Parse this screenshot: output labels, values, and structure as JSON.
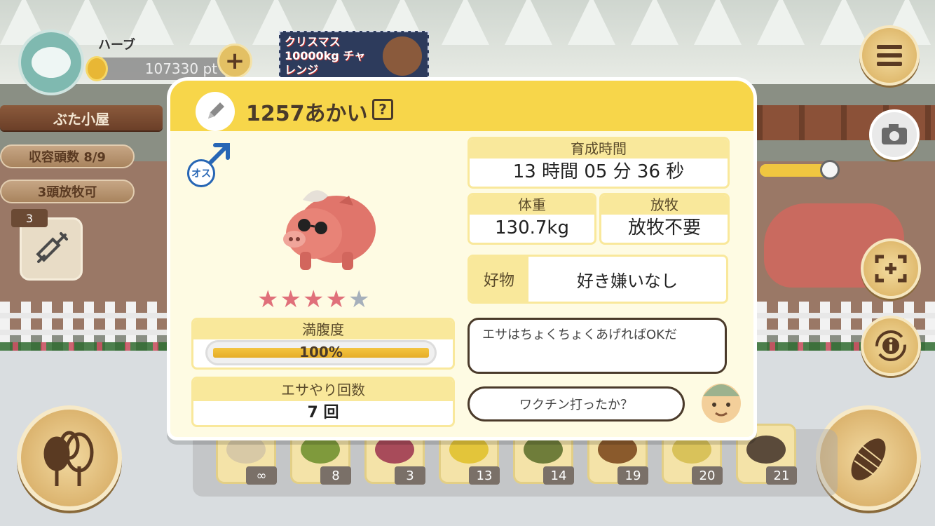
{
  "hud": {
    "player_name": "ハーブ",
    "points": "107330 pt",
    "plus_label": "+",
    "banner_text": "クリスマス 10000kg チャレンジ",
    "area_title": "ぶた小屋",
    "capacity": "収容頭数 8/9",
    "grazing": "3頭放牧可",
    "item_count": "3"
  },
  "modal": {
    "pig_name": "1257あかい",
    "help_label": "?",
    "gender": "オス",
    "stars_filled": 4,
    "stars_total": 5,
    "fullness": {
      "label": "満腹度",
      "value": "100%",
      "fraction": 1.0
    },
    "feed_count": {
      "label": "エサやり回数",
      "value": "7 回"
    },
    "growth_time": {
      "label": "育成時間",
      "value": "13 時間 05 分 36 秒"
    },
    "weight": {
      "label": "体重",
      "value": "130.7kg"
    },
    "grazing": {
      "label": "放牧",
      "value": "放牧不要"
    },
    "likes": {
      "label": "好物",
      "value": "好き嫌いなし"
    },
    "tip": "エサはちょくちょくあげればOKだ",
    "question": "ワクチン打ったか？"
  },
  "food_bar": {
    "items": [
      {
        "qty": "∞",
        "color": "#d8c9a6"
      },
      {
        "qty": "8",
        "color": "#7f9a3c"
      },
      {
        "qty": "3",
        "color": "#a84b5a"
      },
      {
        "qty": "13",
        "color": "#e3c53a"
      },
      {
        "qty": "14",
        "color": "#6f7d3a"
      },
      {
        "qty": "19",
        "color": "#8a5a2c"
      },
      {
        "qty": "20",
        "color": "#d9c25a"
      },
      {
        "qty": "21",
        "color": "#5a4a3a"
      }
    ]
  },
  "colors": {
    "header_yellow": "#f7d64a",
    "male_blue": "#2766b5",
    "star_on": "#e0707a",
    "star_off": "#a6b0bb"
  },
  "icons": [
    "menu-icon",
    "camera-icon",
    "focus-icon",
    "info-cycle-icon",
    "trees-icon",
    "corn-icon",
    "syringe-icon",
    "pencil-icon",
    "male-icon"
  ]
}
